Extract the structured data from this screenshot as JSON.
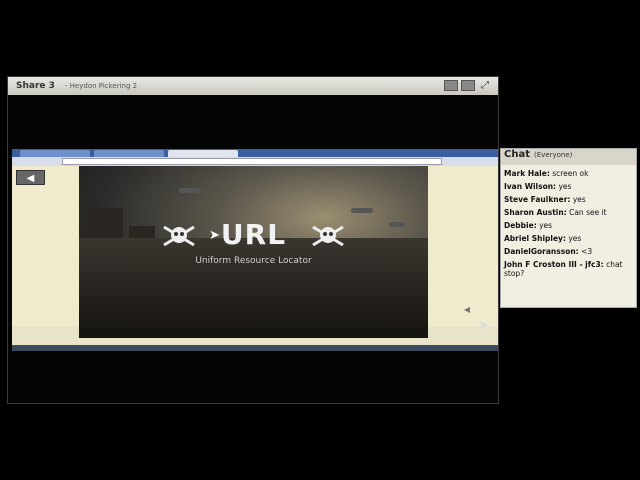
{
  "share": {
    "title": "Share 3",
    "presenter": "- Heydon Pickering 2"
  },
  "slide": {
    "headline": "URL",
    "subtitle": "Uniform Resource Locator"
  },
  "chat": {
    "title": "Chat",
    "scope": "(Everyone)",
    "messages": [
      {
        "sender": "Mark Hale:",
        "text": " screen ok"
      },
      {
        "sender": "Ivan Wilson:",
        "text": " yes"
      },
      {
        "sender": "Steve Faulkner:",
        "text": " yes"
      },
      {
        "sender": "Sharon Austin:",
        "text": " Can see it"
      },
      {
        "sender": "Debbie:",
        "text": " yes"
      },
      {
        "sender": "Abriel Shipley:",
        "text": " yes"
      },
      {
        "sender": "DanielGoransson:",
        "text": " <3"
      },
      {
        "sender": "John F Croston III - jfc3:",
        "text": " chat stop?"
      }
    ]
  }
}
